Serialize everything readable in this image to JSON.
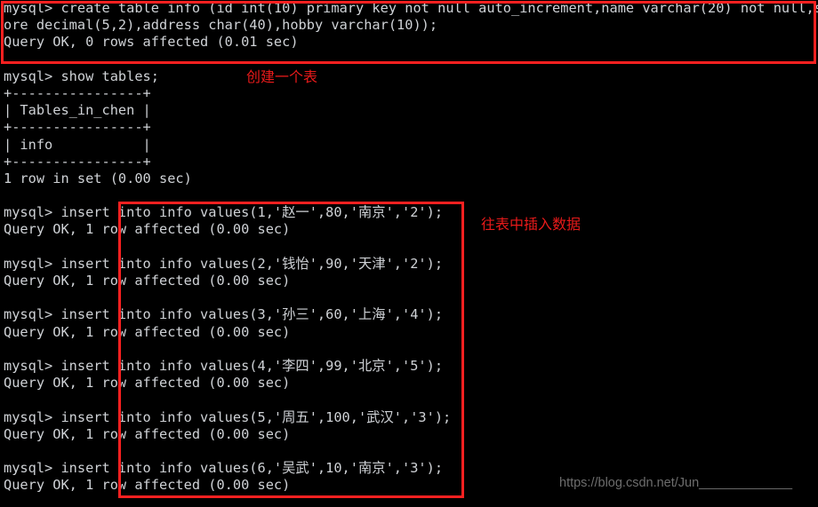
{
  "terminal": {
    "prompt": "mysql>",
    "lines": [
      {
        "type": "text",
        "text": "mysql> create table info (id int(10) primary key not null auto_increment,name varchar(20) not null,sc"
      },
      {
        "type": "text",
        "text": "ore decimal(5,2),address char(40),hobby varchar(10));"
      },
      {
        "type": "text",
        "text": "Query OK, 0 rows affected (0.01 sec)"
      },
      {
        "type": "blank",
        "text": ""
      },
      {
        "type": "text",
        "text": "mysql> show tables;"
      },
      {
        "type": "text",
        "text": "+----------------+"
      },
      {
        "type": "text",
        "text": "| Tables_in_chen |"
      },
      {
        "type": "text",
        "text": "+----------------+"
      },
      {
        "type": "text",
        "text": "| info           |"
      },
      {
        "type": "text",
        "text": "+----------------+"
      },
      {
        "type": "text",
        "text": "1 row in set (0.00 sec)"
      },
      {
        "type": "blank",
        "text": ""
      },
      {
        "type": "text",
        "text": "mysql> insert into info values(1,'赵一',80,'南京','2');"
      },
      {
        "type": "text",
        "text": "Query OK, 1 row affected (0.00 sec)"
      },
      {
        "type": "blank",
        "text": ""
      },
      {
        "type": "text",
        "text": "mysql> insert into info values(2,'钱怡',90,'天津','2');"
      },
      {
        "type": "text",
        "text": "Query OK, 1 row affected (0.00 sec)"
      },
      {
        "type": "blank",
        "text": ""
      },
      {
        "type": "text",
        "text": "mysql> insert into info values(3,'孙三',60,'上海','4');"
      },
      {
        "type": "text",
        "text": "Query OK, 1 row affected (0.00 sec)"
      },
      {
        "type": "blank",
        "text": ""
      },
      {
        "type": "text",
        "text": "mysql> insert into info values(4,'李四',99,'北京','5');"
      },
      {
        "type": "text",
        "text": "Query OK, 1 row affected (0.00 sec)"
      },
      {
        "type": "blank",
        "text": ""
      },
      {
        "type": "text",
        "text": "mysql> insert into info values(5,'周五',100,'武汉','3');"
      },
      {
        "type": "text",
        "text": "Query OK, 1 row affected (0.00 sec)"
      },
      {
        "type": "blank",
        "text": ""
      },
      {
        "type": "text",
        "text": "mysql> insert into info values(6,'吴武',10,'南京','3');"
      },
      {
        "type": "text",
        "text": "Query OK, 1 row affected (0.00 sec)"
      }
    ]
  },
  "annotations": {
    "create_table": "创建一个表",
    "insert_data": "往表中插入数据",
    "box_color": "#fb2020",
    "label_color": "#e81a1a"
  },
  "watermark": {
    "text": "https://blog.csdn.net/Jun_____________",
    "color": "#6d6d6d"
  },
  "theme": {
    "background": "#000000",
    "foreground": "#cfd2d6"
  }
}
